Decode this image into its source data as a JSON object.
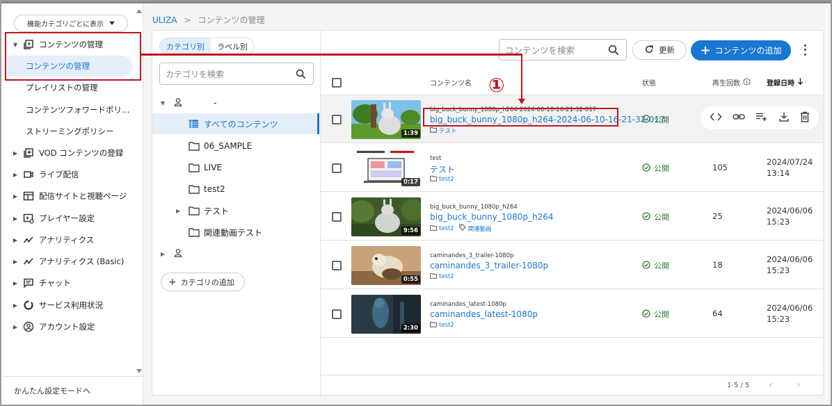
{
  "sidebar": {
    "filter_label": "機能カテゴリごとに表示",
    "menu_active": "コンテンツの管理",
    "sub_items": [
      "コンテンツの管理",
      "プレイリストの管理",
      "コンテンツフォワードポリ…",
      "ストリーミングポリシー"
    ],
    "items": [
      {
        "label": "VOD コンテンツの登録",
        "icon": "add-box-icon"
      },
      {
        "label": "ライブ配信",
        "icon": "videocam-icon"
      },
      {
        "label": "配信サイトと視聴ページ",
        "icon": "web-icon"
      },
      {
        "label": "プレイヤー設定",
        "icon": "player-settings-icon"
      },
      {
        "label": "アナリティクス",
        "icon": "analytics-icon"
      },
      {
        "label": "アナリティクス (Basic)",
        "icon": "analytics-icon"
      },
      {
        "label": "チャット",
        "icon": "chat-icon"
      },
      {
        "label": "サービス利用状況",
        "icon": "donut-icon"
      },
      {
        "label": "アカウント設定",
        "icon": "account-icon"
      }
    ],
    "footer_link": "かんたん設定モードへ"
  },
  "breadcrumb": {
    "root": "ULIZA",
    "separator": ">",
    "current": "コンテンツの管理"
  },
  "categories": {
    "tabs": [
      "カテゴリ別",
      "ラベル別"
    ],
    "search_placeholder": "カテゴリを検索",
    "user_label": "-",
    "all_contents": "すべてのコンテンツ",
    "folders": [
      "06_SAMPLE",
      "LIVE",
      "test2",
      "テスト",
      "関連動画テスト"
    ],
    "add_label": "カテゴリの追加"
  },
  "toolbar": {
    "search_placeholder": "コンテンツを検索",
    "refresh_label": "更新",
    "add_label": "コンテンツの追加"
  },
  "table": {
    "headers": {
      "name": "コンテンツ名",
      "status": "状態",
      "plays": "再生回数",
      "date": "登録日時"
    },
    "rows": [
      {
        "small": "big_buck_bunny_1080p_h264-2024-06-10-16-21-32-017",
        "title": "big_buck_bunny_1080p_h264-2024-06-10-16-21-32-017",
        "category": "テスト",
        "label": "",
        "status": "公開",
        "plays": "",
        "date1": "",
        "date2": "",
        "duration": "1:39"
      },
      {
        "small": "test",
        "title": "テスト",
        "category": "test2",
        "label": "",
        "status": "公開",
        "plays": "105",
        "date1": "2024/07/24",
        "date2": "13:14",
        "duration": "0:17"
      },
      {
        "small": "big_buck_bunny_1080p_h264",
        "title": "big_buck_bunny_1080p_h264",
        "category": "test2",
        "label": "関連動画",
        "status": "公開",
        "plays": "25",
        "date1": "2024/06/06",
        "date2": "15:23",
        "duration": "9:56"
      },
      {
        "small": "caminandes_3_trailer-1080p",
        "title": "caminandes_3_trailer-1080p",
        "category": "test2",
        "label": "",
        "status": "公開",
        "plays": "18",
        "date1": "2024/06/06",
        "date2": "15:23",
        "duration": "0:55"
      },
      {
        "small": "caminandes_latest-1080p",
        "title": "caminandes_latest-1080p",
        "category": "test2",
        "label": "",
        "status": "公開",
        "plays": "64",
        "date1": "2024/06/06",
        "date2": "15:23",
        "duration": "2:30"
      }
    ]
  },
  "pager": {
    "text": "1-5 / 5"
  },
  "annotation": {
    "number": "①"
  },
  "colors": {
    "accent": "#1976d2",
    "status_green": "#2e7d32",
    "annotation_red": "#c0161c",
    "active_bg": "#e3eef9"
  }
}
